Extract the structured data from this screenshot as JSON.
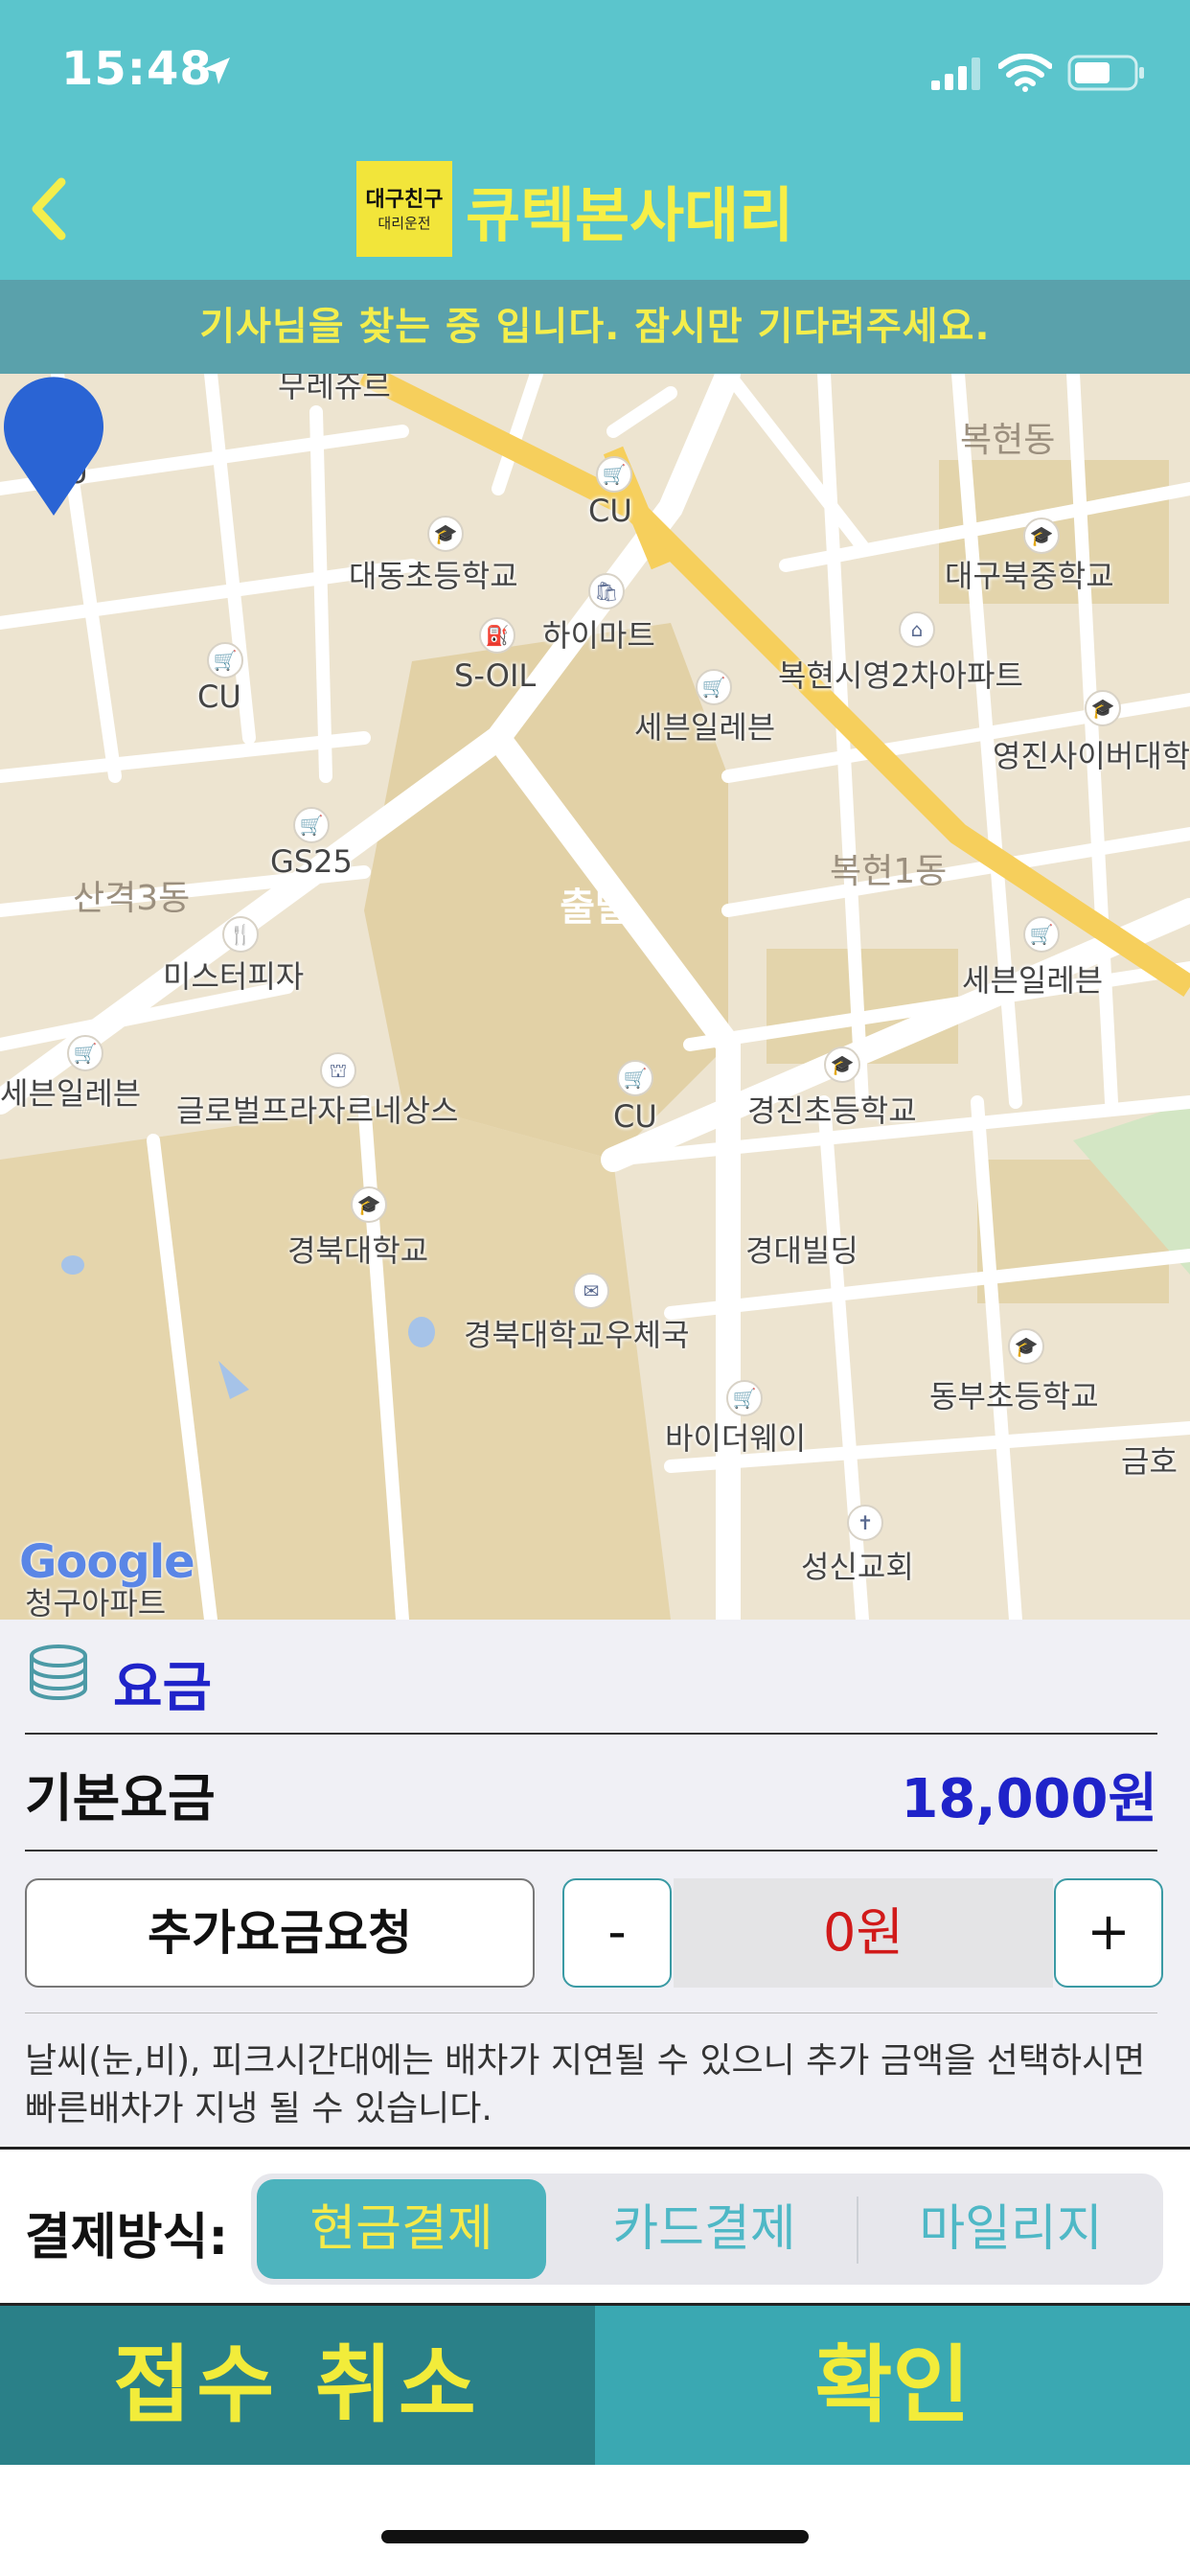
{
  "status_bar": {
    "time": "15:48",
    "icons": [
      "location-arrow-icon",
      "signal-icon",
      "wifi-icon",
      "battery-icon"
    ]
  },
  "header": {
    "logo_top": "대구친구",
    "logo_bottom": "대리운전",
    "title": "큐텍본사대리",
    "back_icon": "chevron-left-icon"
  },
  "banner": {
    "text": "기사님을 찾는 중 입니다.  잠시만 기다려주세요."
  },
  "map": {
    "labels": [
      "무레쥬르",
      "CU",
      "복현동",
      "CU",
      "대동초등학교",
      "대구북중학교",
      "하이마트",
      "S-OIL",
      "CU",
      "복현시영2차아파트",
      "세븐일레븐",
      "영진사이버대학",
      "GS25",
      "산격3동",
      "복현1동",
      "미스터피자",
      "세븐일레븐",
      "세븐일레븐",
      "글로벌프라자르네상스",
      "CU",
      "경진초등학교",
      "경북대학교",
      "경대빌딩",
      "경북대학교우체국",
      "동부초등학교",
      "바이더웨이",
      "금호",
      "성신교회",
      "청구아파트"
    ],
    "pin_label": "출발",
    "attribution": "Google"
  },
  "fare": {
    "title": "요금",
    "base_label": "기본요금",
    "base_value": "18,000원",
    "extra_button": "추가요금요청",
    "minus": "-",
    "extra_amount": "0원",
    "plus": "+",
    "note": "날씨(눈,비), 피크시간대에는 배차가 지연될 수 있으니 추가 금액을 선택하시면 빠른배차가 지냉 될 수 있습니다."
  },
  "payment": {
    "label": "결제방식:",
    "options": [
      "현금결제",
      "카드결제",
      "마일리지"
    ],
    "selected": "현금결제"
  },
  "actions": {
    "cancel": "접수 취소",
    "confirm": "확인"
  },
  "colors": {
    "header_bg": "#5bc5cc",
    "banner_bg": "#5aa1ab",
    "accent_yellow": "#f2ec3a",
    "fare_blue": "#1f23c9",
    "amount_red": "#d11a1a",
    "cancel_bg": "#2a8088",
    "confirm_bg": "#3aa8b2"
  }
}
